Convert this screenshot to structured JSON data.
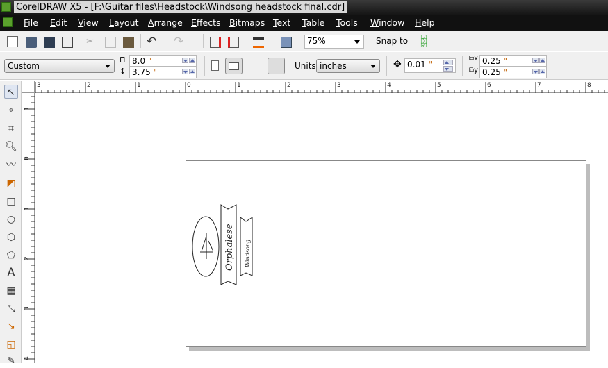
{
  "title": "CorelDRAW X5 - [F:\\Guitar files\\Headstock\\Windsong headstock final.cdr]",
  "menu": [
    "File",
    "Edit",
    "View",
    "Layout",
    "Arrange",
    "Effects",
    "Bitmaps",
    "Text",
    "Table",
    "Tools",
    "Window",
    "Help"
  ],
  "toolbar": {
    "zoom": "75%",
    "snap_to": "Snap to"
  },
  "property_bar": {
    "page_size": "Custom",
    "width": "8.0",
    "height": "3.75",
    "units_label": "Units:",
    "units": "inches",
    "nudge": "0.01",
    "dup_x": "0.25",
    "dup_y": "0.25",
    "inch_mark": "\""
  },
  "rulers": {
    "h": [
      "3",
      "2",
      "1",
      "0",
      "1",
      "2",
      "3",
      "4",
      "5",
      "6",
      "7",
      "8"
    ],
    "v": [
      "1",
      "0",
      "1",
      "2",
      "3",
      "4"
    ]
  },
  "drawing": {
    "text1": "Orphalese",
    "text2": "Windsong"
  }
}
